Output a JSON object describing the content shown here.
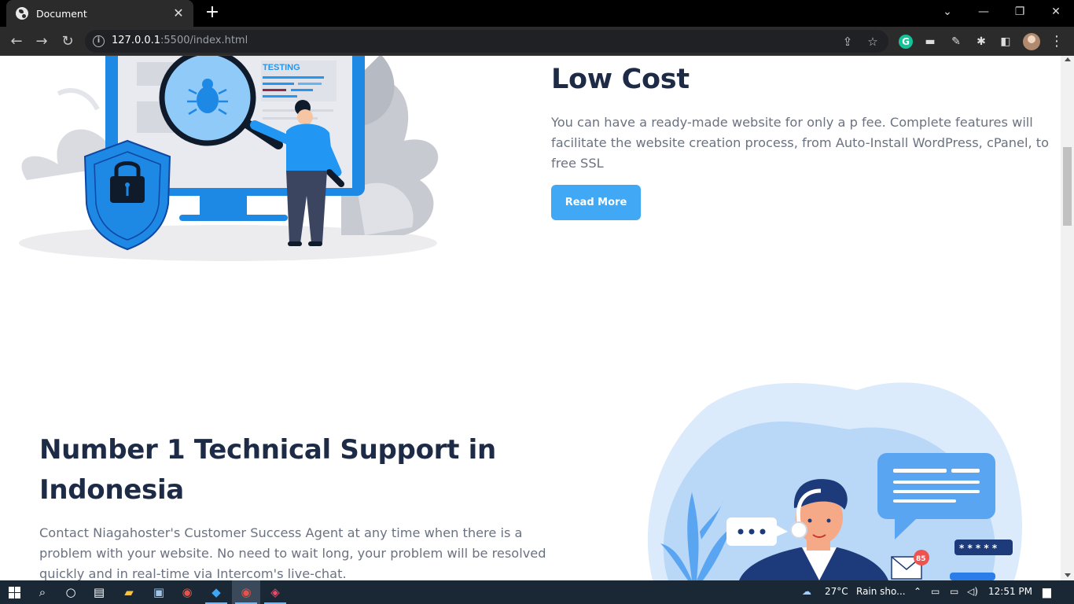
{
  "browser": {
    "tab_title": "Document",
    "tab_close": "✕",
    "new_tab": "+",
    "url_host": "127.0.0.1",
    "url_rest": ":5500/index.html",
    "extension_g": "G",
    "window_controls": {
      "minimize": "—",
      "restore": "❐",
      "close": "✕"
    }
  },
  "page": {
    "low_cost": {
      "heading": "Low Cost",
      "body": "You can have a ready-made website for only a p fee. Complete features will facilitate the website creation process, from Auto-Install WordPress, cPanel, to free SSL",
      "button": "Read More"
    },
    "support": {
      "heading": "Number 1 Technical Support in Indonesia",
      "body": "Contact Niagahoster's Customer Success Agent at any time when there is a problem with your website. No need to wait long, your problem will be resolved quickly and in real-time via Intercom's live-chat."
    },
    "illustration_testing_label": "TESTING",
    "illustration_badge_count": "85",
    "illustration_password_mask": "* * * * *",
    "colors": {
      "accent": "#41a8f6",
      "heading": "#1d2b46",
      "body": "#6b7280"
    }
  },
  "taskbar": {
    "weather_temp": "27°C",
    "weather_text": "Rain sho...",
    "clock": "12:51 PM"
  }
}
